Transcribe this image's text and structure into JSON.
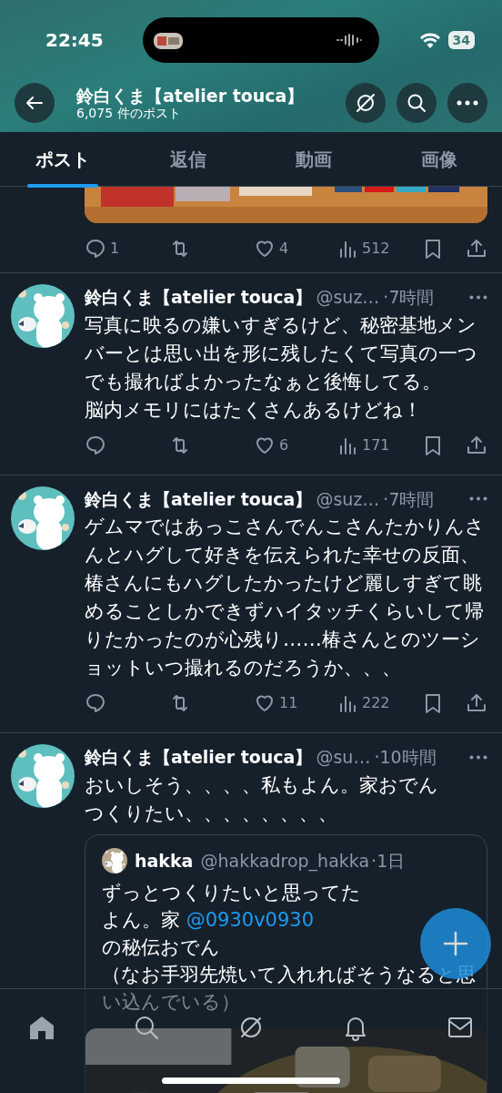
{
  "status_bar": {
    "time": "22:45",
    "battery": "34"
  },
  "header": {
    "title": "鈴白くま【atelier touca】",
    "subtitle": "6,075 件のポスト"
  },
  "tabs": [
    {
      "label": "ポスト",
      "selected": true
    },
    {
      "label": "返信",
      "selected": false
    },
    {
      "label": "動画",
      "selected": false
    },
    {
      "label": "画像",
      "selected": false
    }
  ],
  "posts": [
    {
      "kind": "media_tail",
      "actions": [
        {
          "kind": "reply",
          "count": "1"
        },
        {
          "kind": "repost"
        },
        {
          "kind": "like",
          "count": "4"
        },
        {
          "kind": "views",
          "count": "512"
        },
        {
          "kind": "bookmark"
        },
        {
          "kind": "share"
        }
      ]
    },
    {
      "kind": "post",
      "name": "鈴白くま【atelier touca】",
      "handle": "@suz…",
      "time": "·7時間",
      "paragraphs": [
        "写真に映るの嫌いすぎるけど、秘密基地メンバーとは思い出を形に残したくて写真の一つでも撮ればよかったなぁと後悔してる。",
        "脳内メモリにはたくさんあるけどね！"
      ],
      "actions": [
        {
          "kind": "reply"
        },
        {
          "kind": "repost"
        },
        {
          "kind": "like",
          "count": "6"
        },
        {
          "kind": "views",
          "count": "171"
        },
        {
          "kind": "bookmark"
        },
        {
          "kind": "share"
        }
      ]
    },
    {
      "kind": "post",
      "name": "鈴白くま【atelier touca】",
      "handle": "@suz…",
      "time": "·7時間",
      "paragraphs": [
        "ゲムマではあっこさんでんこさんたかりんさんとハグして好きを伝えられた幸せの反面、椿さんにもハグしたかったけど麗しすぎて眺めることしかできずハイタッチくらいして帰りたかったのが心残り……椿さんとのツーショットいつ撮れるのだろうか、、、"
      ],
      "actions": [
        {
          "kind": "reply"
        },
        {
          "kind": "repost"
        },
        {
          "kind": "like",
          "count": "11"
        },
        {
          "kind": "views",
          "count": "222"
        },
        {
          "kind": "bookmark"
        },
        {
          "kind": "share"
        }
      ]
    },
    {
      "kind": "post",
      "name": "鈴白くま【atelier touca】",
      "handle": "@su…",
      "time": "·10時間",
      "paragraphs": [
        "おいしそう、、、、私もよん。家おでん",
        "つくりたい、、、、、、、、"
      ],
      "quote": {
        "name": "hakka",
        "handle": "@hakkadrop_hakka",
        "time": "·1日",
        "lines": [
          [
            {
              "kind": "text",
              "text": "ずっとつくりたいと思ってた"
            }
          ],
          [
            {
              "kind": "text",
              "text": "よん。家 "
            },
            {
              "kind": "mention",
              "text": "@0930v0930"
            }
          ],
          [
            {
              "kind": "text",
              "text": "の秘伝おでん"
            }
          ],
          [
            {
              "kind": "text",
              "text": "（なお手羽先焼いて入れればそうなると思い込んでいる）"
            }
          ]
        ]
      }
    }
  ],
  "bottom_nav": [
    {
      "kind": "home"
    },
    {
      "kind": "search"
    },
    {
      "kind": "grok"
    },
    {
      "kind": "notifications"
    },
    {
      "kind": "messages"
    }
  ]
}
